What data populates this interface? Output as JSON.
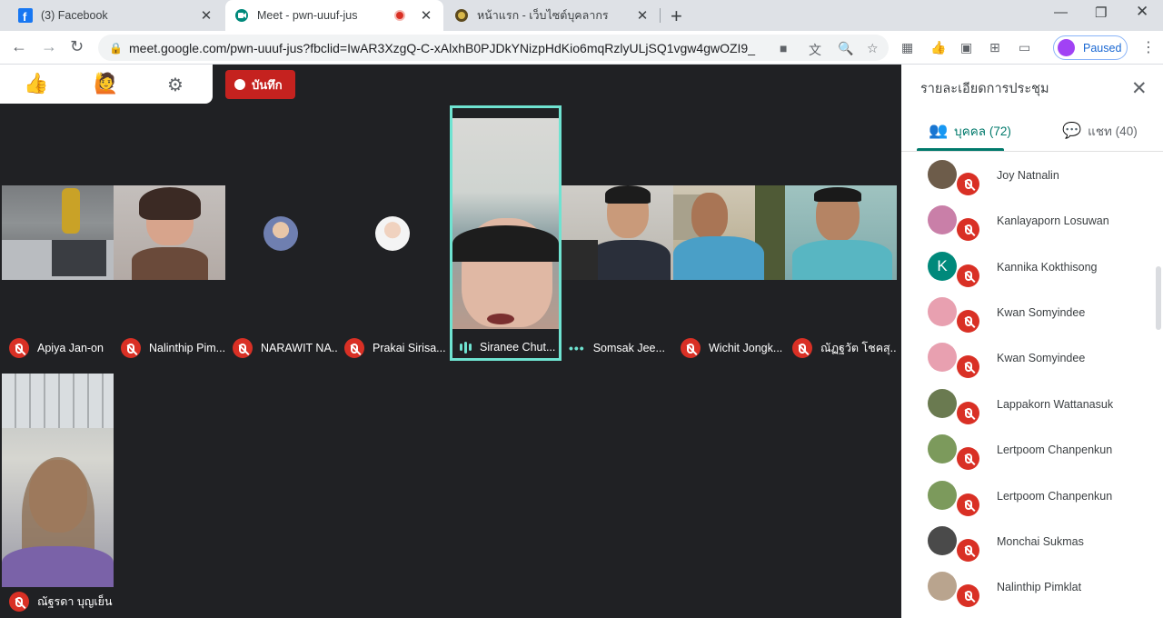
{
  "browser": {
    "tabs": [
      {
        "title": "(3) Facebook",
        "icon": "facebook-icon"
      },
      {
        "title": "Meet - pwn-uuuf-jus",
        "icon": "google-meet-icon",
        "recording": true
      },
      {
        "title": "หน้าแรก - เว็บไซต์บุคลากร",
        "icon": "site-seal-icon"
      }
    ],
    "url": "meet.google.com/pwn-uuuf-jus?fbclid=IwAR3XzgQ-C-xAlxhB0PJDkYNizpHdKio6mqRzlyULjSQ1vgw4gwOZI9_N...",
    "profile_label": "Paused"
  },
  "meet": {
    "reactions": {
      "thumbs_up": "👍",
      "raise_hand": "🙋"
    },
    "record_label": "บันทึก",
    "tiles": [
      {
        "name": "Apiya Jan-on",
        "muted": true
      },
      {
        "name": "Nalinthip Pim...",
        "muted": true
      },
      {
        "name": "NARAWIT NA...",
        "muted": true
      },
      {
        "name": "Prakai Sirisa...",
        "muted": true
      },
      {
        "name": "Siranee Chut...",
        "muted": false,
        "speaking": true
      },
      {
        "name": "Somsak Jee...",
        "muted": false
      },
      {
        "name": "Wichit Jongk...",
        "muted": true
      },
      {
        "name": "ณัฏฐวัต โชคสุ...",
        "muted": true
      },
      {
        "name": "ณัฐรดา บุญเย็น",
        "muted": true
      }
    ]
  },
  "panel": {
    "title": "รายละเอียดการประชุม",
    "tab_people": "บุคคล (72)",
    "tab_chat": "แชท (40)",
    "people": [
      {
        "name": "Joy Natnalin",
        "avatar": "photo",
        "color": "#6d5c4a"
      },
      {
        "name": "Kanlayaporn Losuwan",
        "avatar": "photo",
        "color": "#c97fa8"
      },
      {
        "name": "Kannika Kokthisong",
        "avatar": "K",
        "color": "#00897b"
      },
      {
        "name": "Kwan Somyindee",
        "avatar": "photo",
        "color": "#e8a0b0"
      },
      {
        "name": "Kwan Somyindee",
        "avatar": "photo",
        "color": "#e8a0b0"
      },
      {
        "name": "Lappakorn Wattanasuk",
        "avatar": "photo",
        "color": "#6a7a50"
      },
      {
        "name": "Lertpoom Chanpenkun",
        "avatar": "photo",
        "color": "#7c9a5c"
      },
      {
        "name": "Lertpoom Chanpenkun",
        "avatar": "photo",
        "color": "#7c9a5c"
      },
      {
        "name": "Monchai Sukmas",
        "avatar": "photo",
        "color": "#4a4a4a"
      },
      {
        "name": "Nalinthip Pimklat",
        "avatar": "photo",
        "color": "#b9a48e"
      }
    ]
  }
}
